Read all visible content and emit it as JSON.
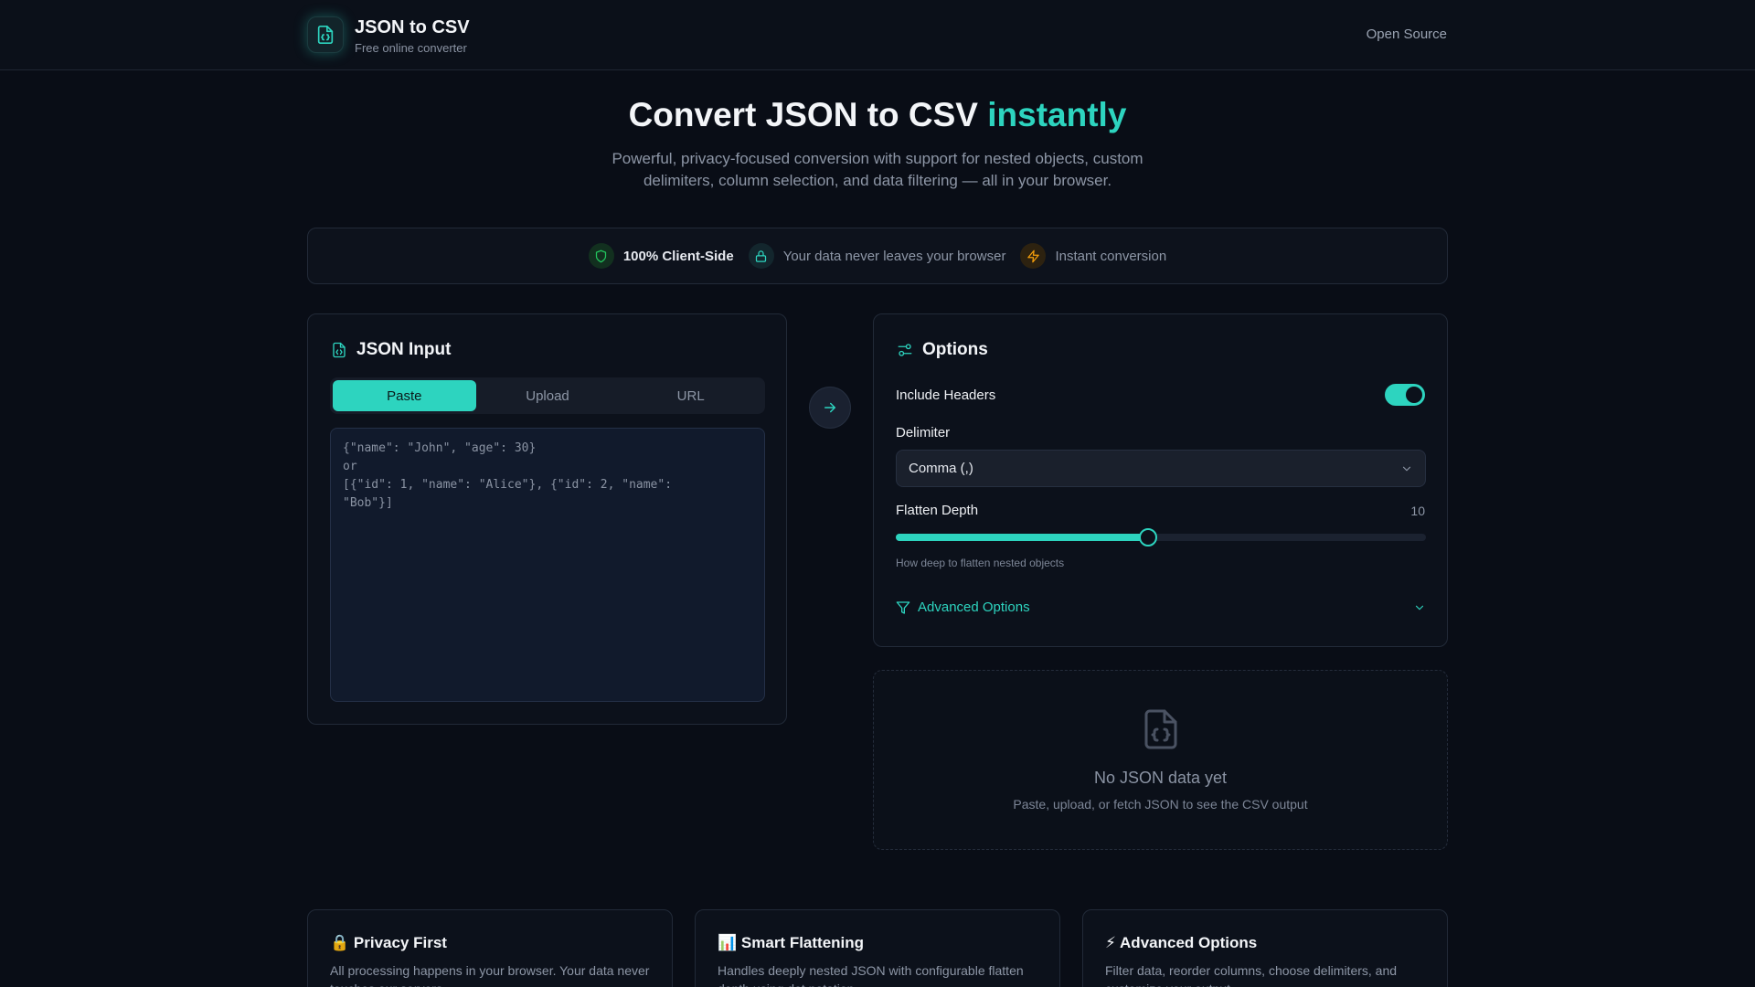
{
  "header": {
    "title": "JSON to CSV",
    "subtitle": "Free online converter",
    "open_source": "Open Source"
  },
  "hero": {
    "title_main": "Convert JSON to CSV ",
    "title_accent": "instantly",
    "subtitle": "Powerful, privacy-focused conversion with support for nested objects, custom delimiters, column selection, and data filtering — all in your browser."
  },
  "trust": {
    "client_side": "100% Client-Side",
    "privacy": "Your data never leaves your browser",
    "instant": "Instant conversion"
  },
  "input_card": {
    "title": "JSON Input",
    "tabs": [
      "Paste",
      "Upload",
      "URL"
    ],
    "active_tab": "Paste",
    "placeholder": "{\"name\": \"John\", \"age\": 30}\nor\n[{\"id\": 1, \"name\": \"Alice\"}, {\"id\": 2, \"name\":\n\"Bob\"}]"
  },
  "options": {
    "title": "Options",
    "include_headers_label": "Include Headers",
    "include_headers": true,
    "delimiter_label": "Delimiter",
    "delimiter_value": "Comma (,)",
    "flatten_label": "Flatten Depth",
    "flatten_value": "10",
    "flatten_fraction": 0.475,
    "flatten_hint": "How deep to flatten nested objects",
    "advanced_label": "Advanced Options"
  },
  "empty_state": {
    "title": "No JSON data yet",
    "subtitle": "Paste, upload, or fetch JSON to see the CSV output"
  },
  "features": [
    {
      "icon": "🔒",
      "title": "Privacy First",
      "text": "All processing happens in your browser. Your data never touches our servers."
    },
    {
      "icon": "📊",
      "title": "Smart Flattening",
      "text": "Handles deeply nested JSON with configurable flatten depth using dot notation."
    },
    {
      "icon": "⚡",
      "title": "Advanced Options",
      "text": "Filter data, reorder columns, choose delimiters, and customize your output."
    }
  ],
  "colors": {
    "accent": "#2dd4bf",
    "background": "#090d16",
    "card": "#0c111b"
  }
}
